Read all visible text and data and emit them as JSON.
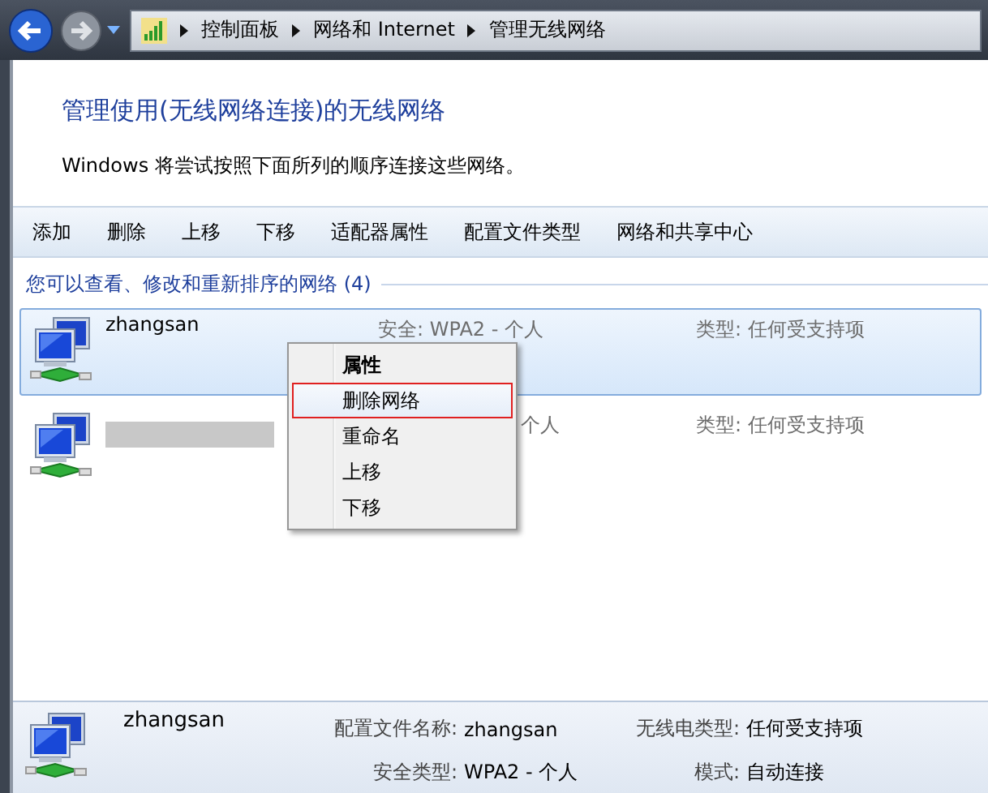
{
  "address_bar": {
    "breadcrumbs": [
      "控制面板",
      "网络和 Internet",
      "管理无线网络"
    ]
  },
  "header": {
    "title": "管理使用(无线网络连接)的无线网络",
    "subtitle": "Windows 将尝试按照下面所列的顺序连接这些网络。"
  },
  "toolbar": [
    "添加",
    "删除",
    "上移",
    "下移",
    "适配器属性",
    "配置文件类型",
    "网络和共享中心"
  ],
  "group": {
    "heading": "您可以查看、修改和重新排序的网络 (4)"
  },
  "networks": [
    {
      "name": "zhangsan",
      "redacted": false,
      "covered": false,
      "security": "安全: WPA2 - 个人",
      "type": "类型: 任何受支持项",
      "selected": true
    },
    {
      "redacted": true,
      "covered": true,
      "security": "个人",
      "type": "类型: 任何受支持项",
      "selected": false
    }
  ],
  "context_menu": [
    {
      "label": "属性",
      "default": true,
      "selected": false
    },
    {
      "label": "删除网络",
      "default": false,
      "selected": true
    },
    {
      "label": "重命名",
      "default": false,
      "selected": false
    },
    {
      "label": "上移",
      "default": false,
      "selected": false
    },
    {
      "label": "下移",
      "default": false,
      "selected": false
    }
  ],
  "details": {
    "name": "zhangsan",
    "fields": [
      {
        "label": "配置文件名称:",
        "value": "zhangsan"
      },
      {
        "label": "无线电类型:",
        "value": "任何受支持项"
      },
      {
        "label": "安全类型:",
        "value": "WPA2 - 个人"
      },
      {
        "label": "模式:",
        "value": "自动连接"
      }
    ]
  }
}
